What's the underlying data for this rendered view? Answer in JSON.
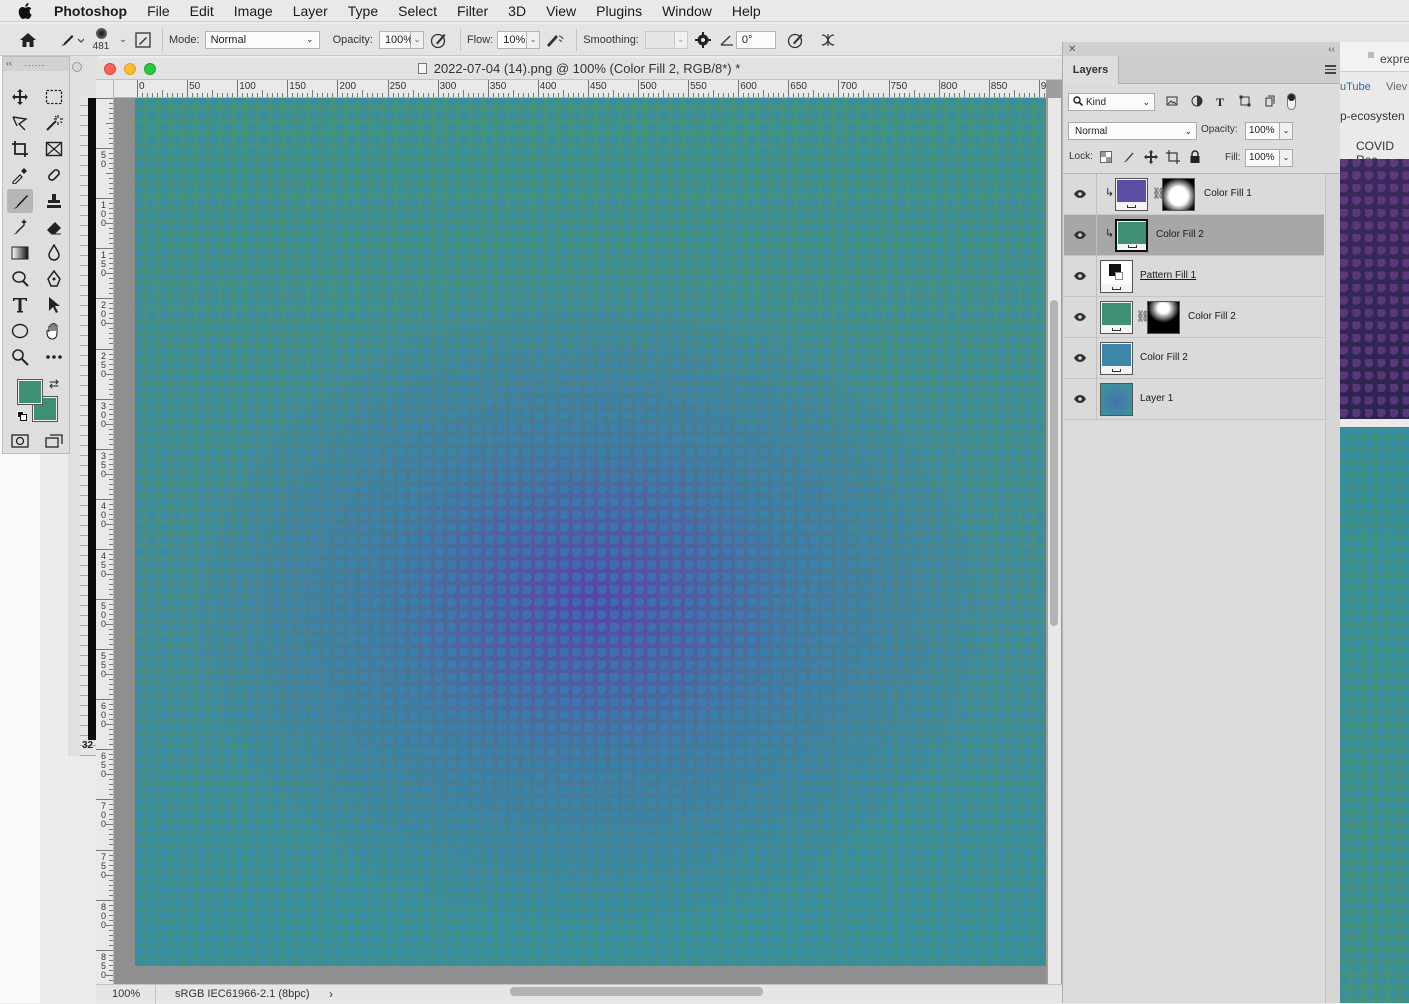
{
  "menubar": {
    "app_name": "Photoshop",
    "items": [
      "File",
      "Edit",
      "Image",
      "Layer",
      "Type",
      "Select",
      "Filter",
      "3D",
      "View",
      "Plugins",
      "Window",
      "Help"
    ]
  },
  "options": {
    "brush_size": "481",
    "mode_label": "Mode:",
    "mode_value": "Normal",
    "opacity_label": "Opacity:",
    "opacity_value": "100%",
    "flow_label": "Flow:",
    "flow_value": "10%",
    "smoothing_label": "Smoothing:",
    "smoothing_value": "",
    "angle_value": "0°"
  },
  "document": {
    "title": "2022-07-04 (14).png @ 100% (Color Fill 2, RGB/8*) *",
    "ruler_h": [
      "0",
      "50",
      "100",
      "150",
      "200",
      "250",
      "300",
      "350",
      "400",
      "450",
      "500",
      "550",
      "600",
      "650",
      "700",
      "750",
      "800",
      "850",
      "90"
    ],
    "ruler_v": [
      "5\n0",
      "1\n0\n0",
      "1\n5\n0",
      "2\n0\n0",
      "2\n5\n0",
      "3\n0\n0",
      "3\n5\n0",
      "4\n0\n0",
      "4\n5\n0",
      "5\n0\n0",
      "5\n5\n0",
      "6\n0\n0",
      "6\n5\n0",
      "7\n0\n0",
      "7\n5\n0",
      "8\n0\n0",
      "8\n5\n0"
    ],
    "zoom": "100%",
    "profile": "sRGB IEC61966-2.1 (8bpc)",
    "bg_zoom_fragment": "32"
  },
  "colors": {
    "foreground": "#3f8f77",
    "background": "#3f8f72",
    "canvas_green": "#46927b",
    "canvas_purple": "#5840a8",
    "pattern_blue": "#288cc8"
  },
  "layers_panel": {
    "tab": "Layers",
    "filter_kind": "Kind",
    "blend_mode": "Normal",
    "opacity_label": "Opacity:",
    "opacity_value": "100%",
    "lock_label": "Lock:",
    "fill_label": "Fill:",
    "fill_value": "100%",
    "layers": [
      {
        "name": "Color Fill 1",
        "swatch": "#5a4ea6",
        "mask": "white-center",
        "clipped": true,
        "selected": false
      },
      {
        "name": "Color Fill 2",
        "swatch": "#3f8f72",
        "mask": "none",
        "clipped": true,
        "selected": true
      },
      {
        "name": "Pattern Fill 1",
        "swatch": "#111111",
        "mask": "none",
        "clipped": false,
        "selected": false
      },
      {
        "name": "Color Fill 2",
        "swatch": "#3f8f72",
        "mask": "white-top",
        "clipped": false,
        "selected": false
      },
      {
        "name": "Color Fill 2",
        "swatch": "#3e86a8",
        "mask": "none",
        "clipped": false,
        "selected": false
      },
      {
        "name": "Layer 1",
        "swatch": "#3a8fa0",
        "mask": "none",
        "clipped": false,
        "selected": false
      }
    ]
  },
  "browser": {
    "snippets": [
      "expre",
      "uTube",
      "Viev",
      "p-ecosysten",
      "COVID Rec"
    ]
  }
}
